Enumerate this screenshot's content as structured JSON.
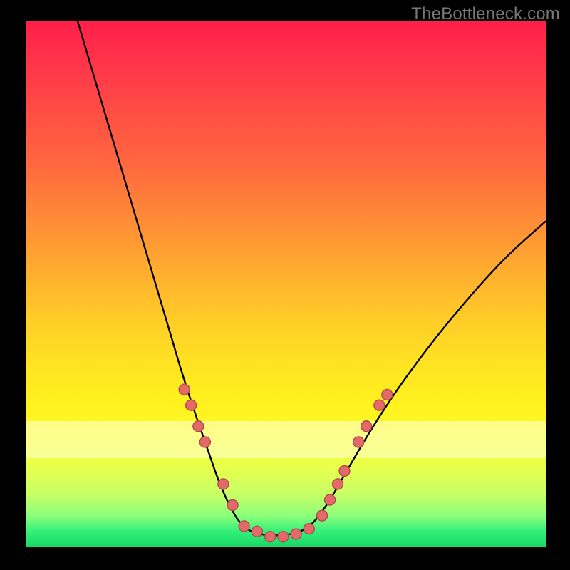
{
  "watermark": "TheBottleneck.com",
  "colors": {
    "background": "#000000",
    "gradient_top": "#ff1f4a",
    "gradient_mid": "#ffe522",
    "gradient_bottom": "#17d765",
    "curve": "#000000",
    "dot_fill": "#e46a6a",
    "dot_stroke": "#b24a4a"
  },
  "chart_data": {
    "type": "line",
    "title": "",
    "xlabel": "",
    "ylabel": "",
    "xlim": [
      0,
      100
    ],
    "ylim": [
      0,
      100
    ],
    "grid": false,
    "legend": false,
    "curve_description": "V-shaped curve: steep descent from top-left to a flat valley around x 42-55 near the bottom, then a rounded rise to about 60% height on the right edge",
    "curve_points": [
      {
        "x": 10.0,
        "y": 100
      },
      {
        "x": 13.0,
        "y": 90
      },
      {
        "x": 16.0,
        "y": 80
      },
      {
        "x": 19.0,
        "y": 70
      },
      {
        "x": 22.0,
        "y": 60
      },
      {
        "x": 25.0,
        "y": 50
      },
      {
        "x": 28.0,
        "y": 40
      },
      {
        "x": 31.0,
        "y": 30
      },
      {
        "x": 34.5,
        "y": 20
      },
      {
        "x": 38.0,
        "y": 10
      },
      {
        "x": 42.0,
        "y": 3
      },
      {
        "x": 48.0,
        "y": 2
      },
      {
        "x": 54.0,
        "y": 3
      },
      {
        "x": 58.0,
        "y": 8
      },
      {
        "x": 62.0,
        "y": 15
      },
      {
        "x": 68.0,
        "y": 25
      },
      {
        "x": 75.0,
        "y": 35
      },
      {
        "x": 83.0,
        "y": 45
      },
      {
        "x": 92.0,
        "y": 55
      },
      {
        "x": 100.0,
        "y": 62
      }
    ],
    "dot_points": [
      {
        "x": 30.5,
        "y": 30
      },
      {
        "x": 31.8,
        "y": 27
      },
      {
        "x": 33.2,
        "y": 23
      },
      {
        "x": 34.5,
        "y": 20
      },
      {
        "x": 38.0,
        "y": 12
      },
      {
        "x": 39.8,
        "y": 8
      },
      {
        "x": 42.0,
        "y": 4
      },
      {
        "x": 44.5,
        "y": 3
      },
      {
        "x": 47.0,
        "y": 2
      },
      {
        "x": 49.5,
        "y": 2
      },
      {
        "x": 52.0,
        "y": 2.5
      },
      {
        "x": 54.5,
        "y": 3.5
      },
      {
        "x": 57.0,
        "y": 6
      },
      {
        "x": 58.5,
        "y": 9
      },
      {
        "x": 60.0,
        "y": 12
      },
      {
        "x": 61.3,
        "y": 14.5
      },
      {
        "x": 64.0,
        "y": 20
      },
      {
        "x": 65.5,
        "y": 23
      },
      {
        "x": 68.0,
        "y": 27
      },
      {
        "x": 69.5,
        "y": 29
      }
    ]
  }
}
